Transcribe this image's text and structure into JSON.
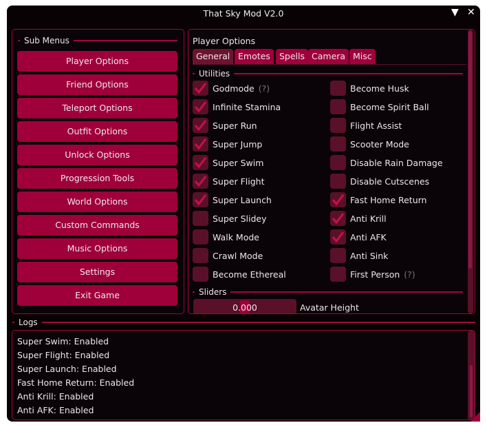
{
  "window": {
    "title": "That Sky Mod V2.0",
    "collapse_icon": "triangle-down-icon",
    "close_icon": "close-icon"
  },
  "colors": {
    "accent": "#a0003a",
    "checkbox": "#5a1028",
    "background": "#080205"
  },
  "submenus": {
    "header": "Sub Menus",
    "items": [
      "Player Options",
      "Friend Options",
      "Teleport Options",
      "Outfit Options",
      "Unlock Options",
      "Progression Tools",
      "World Options",
      "Custom Commands",
      "Music Options",
      "Settings",
      "Exit Game"
    ]
  },
  "main": {
    "title": "Player Options",
    "tabs": [
      {
        "label": "General",
        "active": true
      },
      {
        "label": "Emotes"
      },
      {
        "label": "Spells"
      },
      {
        "label": "Camera"
      },
      {
        "label": "Misc"
      }
    ],
    "utilities_header": "Utilities",
    "left_options": [
      {
        "label": "Godmode",
        "checked": true,
        "help": "(?)"
      },
      {
        "label": "Infinite Stamina",
        "checked": true
      },
      {
        "label": "Super Run",
        "checked": true
      },
      {
        "label": "Super Jump",
        "checked": true
      },
      {
        "label": "Super Swim",
        "checked": true
      },
      {
        "label": "Super Flight",
        "checked": true
      },
      {
        "label": "Super Launch",
        "checked": true
      },
      {
        "label": "Super Slidey",
        "checked": false
      },
      {
        "label": "Walk Mode",
        "checked": false
      },
      {
        "label": "Crawl Mode",
        "checked": false
      },
      {
        "label": "Become Ethereal",
        "checked": false
      }
    ],
    "right_options": [
      {
        "label": "Become Husk",
        "checked": false
      },
      {
        "label": "Become Spirit Ball",
        "checked": false
      },
      {
        "label": "Flight Assist",
        "checked": false
      },
      {
        "label": "Scooter Mode",
        "checked": false
      },
      {
        "label": "Disable Rain Damage",
        "checked": false
      },
      {
        "label": "Disable Cutscenes",
        "checked": false
      },
      {
        "label": "Fast Home Return",
        "checked": true
      },
      {
        "label": "Anti Krill",
        "checked": true
      },
      {
        "label": "Anti AFK",
        "checked": true
      },
      {
        "label": "Anti Sink",
        "checked": false
      },
      {
        "label": "First Person",
        "checked": false,
        "help": "(?)"
      }
    ],
    "sliders_header": "Sliders",
    "slider": {
      "value": "0.000",
      "label": "Avatar Height"
    }
  },
  "logs": {
    "header": "Logs",
    "lines": [
      "Super Swim: Enabled",
      "Super Flight: Enabled",
      "Super Launch: Enabled",
      "Fast Home Return: Enabled",
      "Anti Krill: Enabled",
      "Anti AFK: Enabled"
    ]
  }
}
